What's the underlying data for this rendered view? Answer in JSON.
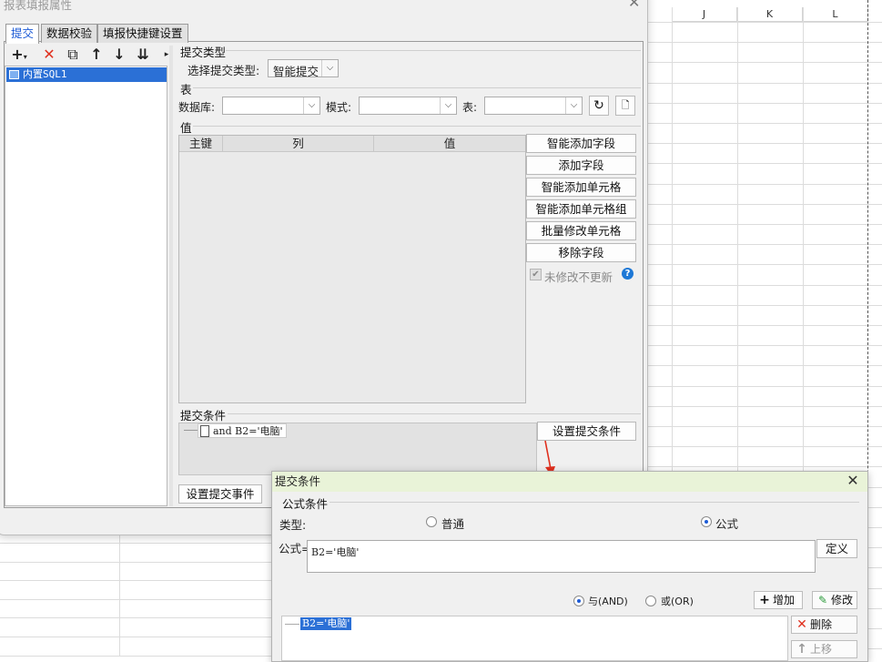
{
  "sheet": {
    "columns": [
      "J",
      "K",
      "L"
    ]
  },
  "main_dialog": {
    "title": "报表填报属性",
    "tabs": [
      "提交",
      "数据校验",
      "填报快捷键设置"
    ],
    "tree": {
      "items": [
        "内置SQL1"
      ]
    },
    "submit_type": {
      "section": "提交类型",
      "label": "选择提交类型:",
      "value": "智能提交"
    },
    "table_section": {
      "section": "表",
      "database_label": "数据库:",
      "database_value": "",
      "schema_label": "模式:",
      "schema_value": "",
      "table_label": "表:",
      "table_value": ""
    },
    "value_section": {
      "section": "值",
      "columns": [
        "主键",
        "列",
        "值"
      ],
      "buttons": [
        "智能添加字段",
        "添加字段",
        "智能添加单元格",
        "智能添加单元格组",
        "批量修改单元格",
        "移除字段"
      ],
      "unmodified_label": "未修改不更新",
      "unmodified_checked": true
    },
    "submit_condition": {
      "section": "提交条件",
      "node": "and B2='电脑'",
      "set_button": "设置提交条件"
    },
    "set_event_button": "设置提交事件"
  },
  "condition_dialog": {
    "title": "提交条件",
    "group_label": "公式条件",
    "type_label": "类型:",
    "radio_normal": "普通",
    "radio_formula": "公式",
    "selected_type": "公式",
    "formula_label": "公式=",
    "formula_value": "B2='电脑'",
    "define_button": "定义",
    "and_label": "与(AND)",
    "or_label": "或(OR)",
    "selected_logic": "与(AND)",
    "add_button": "增加",
    "modify_button": "修改",
    "list_items": [
      "B2='电脑'"
    ],
    "delete_button": "删除",
    "move_up_button": "上移"
  },
  "colors": {
    "accent": "#2b70d6",
    "dialog_title_bg": "#e9f3d8",
    "delete_red": "#e0301e",
    "arrow_red": "#e0301e"
  }
}
